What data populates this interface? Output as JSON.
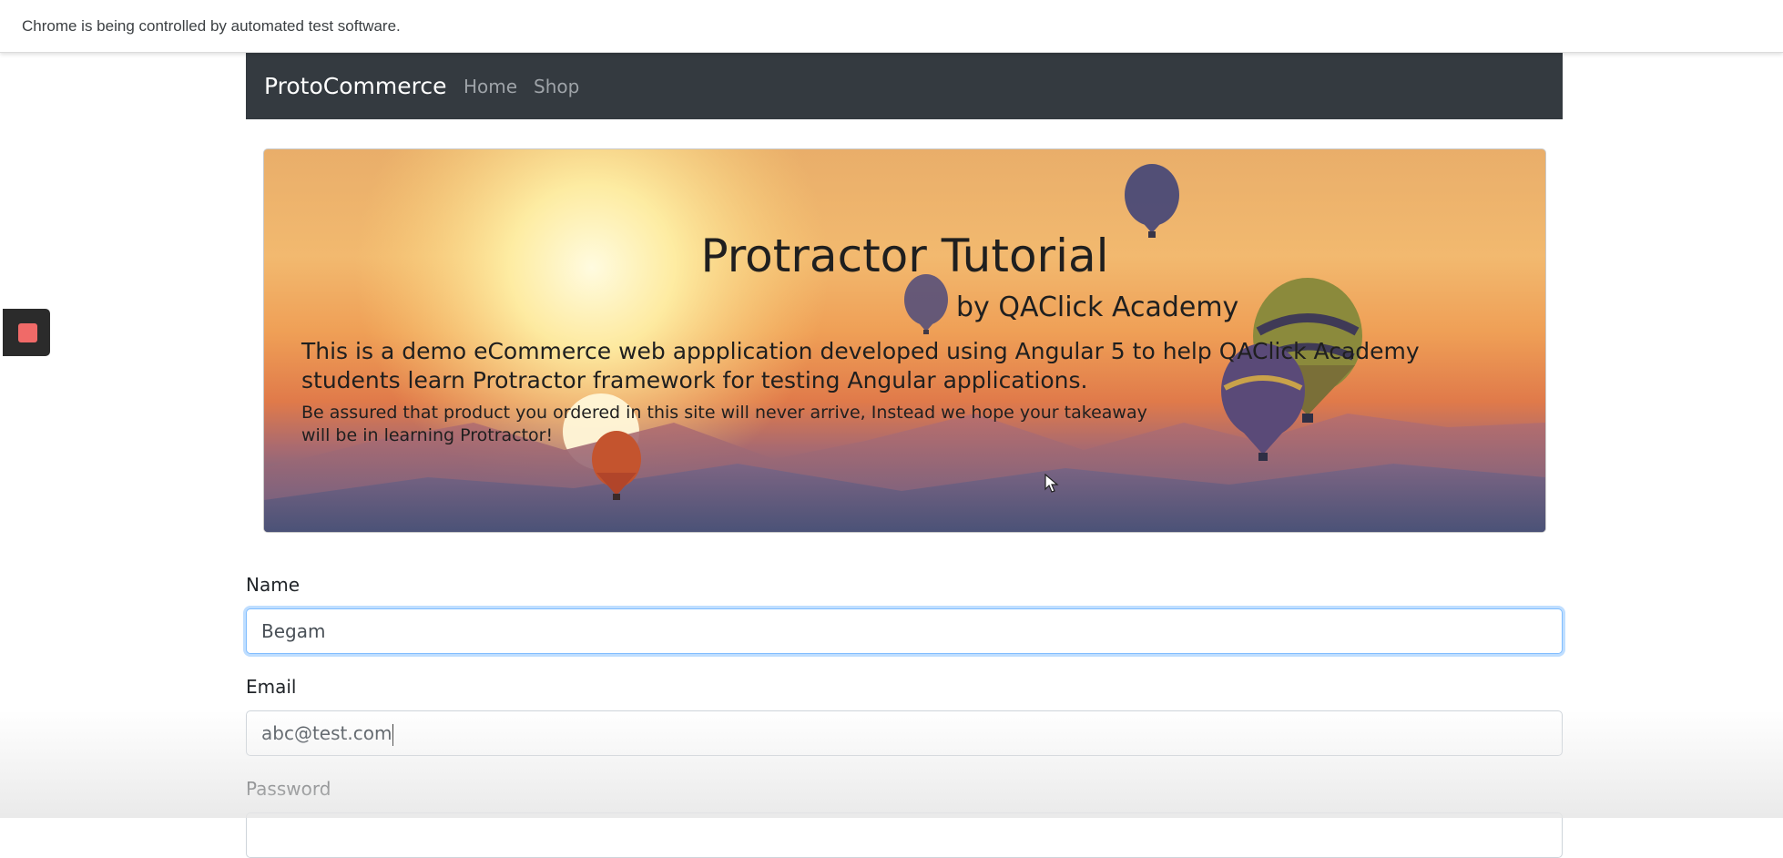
{
  "automation_bar": {
    "message": "Chrome is being controlled by automated test software."
  },
  "recording_widget": {
    "icon": "stop-icon",
    "color": "#f06a68"
  },
  "navbar": {
    "brand": "ProtoCommerce",
    "links": [
      {
        "label": "Home"
      },
      {
        "label": "Shop"
      }
    ],
    "background": "#343a40"
  },
  "hero": {
    "title": "Protractor Tutorial",
    "subtitle": "by QAClick Academy",
    "paragraph1": "This is a demo eCommerce web appplication developed using Angular 5 to help QAClick Academy students learn Protractor framework for testing Angular applications.",
    "paragraph2": "Be assured that product you ordered in this site will never arrive, Instead we hope your takeaway will be in learning Protractor!"
  },
  "form": {
    "name": {
      "label": "Name",
      "value": "Begam"
    },
    "email": {
      "label": "Email",
      "value": "abc@test.com"
    },
    "password": {
      "label": "Password",
      "value": ""
    }
  },
  "colors": {
    "focus_ring": "#80bdff"
  }
}
